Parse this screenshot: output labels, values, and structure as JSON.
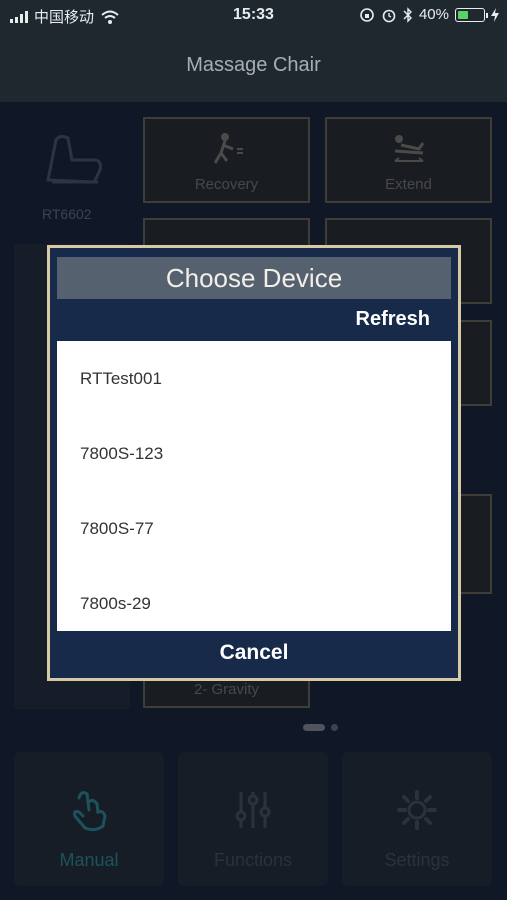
{
  "status_bar": {
    "carrier": "中国移动",
    "time": "15:33",
    "battery_percent": "40%",
    "battery_level": 0.4,
    "icons": [
      "signal-icon",
      "wifi-icon",
      "orientation-lock-icon",
      "alarm-icon",
      "bluetooth-icon",
      "battery-icon",
      "charging-icon"
    ]
  },
  "header": {
    "title": "Massage Chair"
  },
  "device": {
    "model": "RT6602"
  },
  "programs": [
    {
      "label": "Recovery",
      "icon": "recovery-icon"
    },
    {
      "label": "Extend",
      "icon": "extend-icon"
    },
    {
      "label": "Zero-Gravity",
      "icon": "zero-gravity-icon",
      "visible_text": "2- Gravity"
    }
  ],
  "nav": {
    "tabs": [
      {
        "label": "Manual",
        "icon": "hand-icon",
        "active": true
      },
      {
        "label": "Functions",
        "icon": "sliders-icon",
        "active": false
      },
      {
        "label": "Settings",
        "icon": "gear-icon",
        "active": false
      }
    ]
  },
  "dialog": {
    "title": "Choose Device",
    "refresh_label": "Refresh",
    "cancel_label": "Cancel",
    "devices": [
      "RTTest001",
      "7800S-123",
      "7800S-77",
      "7800s-29"
    ]
  },
  "colors": {
    "dialog_bg": "#172a4a",
    "dialog_border": "#d8c9a5",
    "accent_active": "#2f8d93"
  }
}
